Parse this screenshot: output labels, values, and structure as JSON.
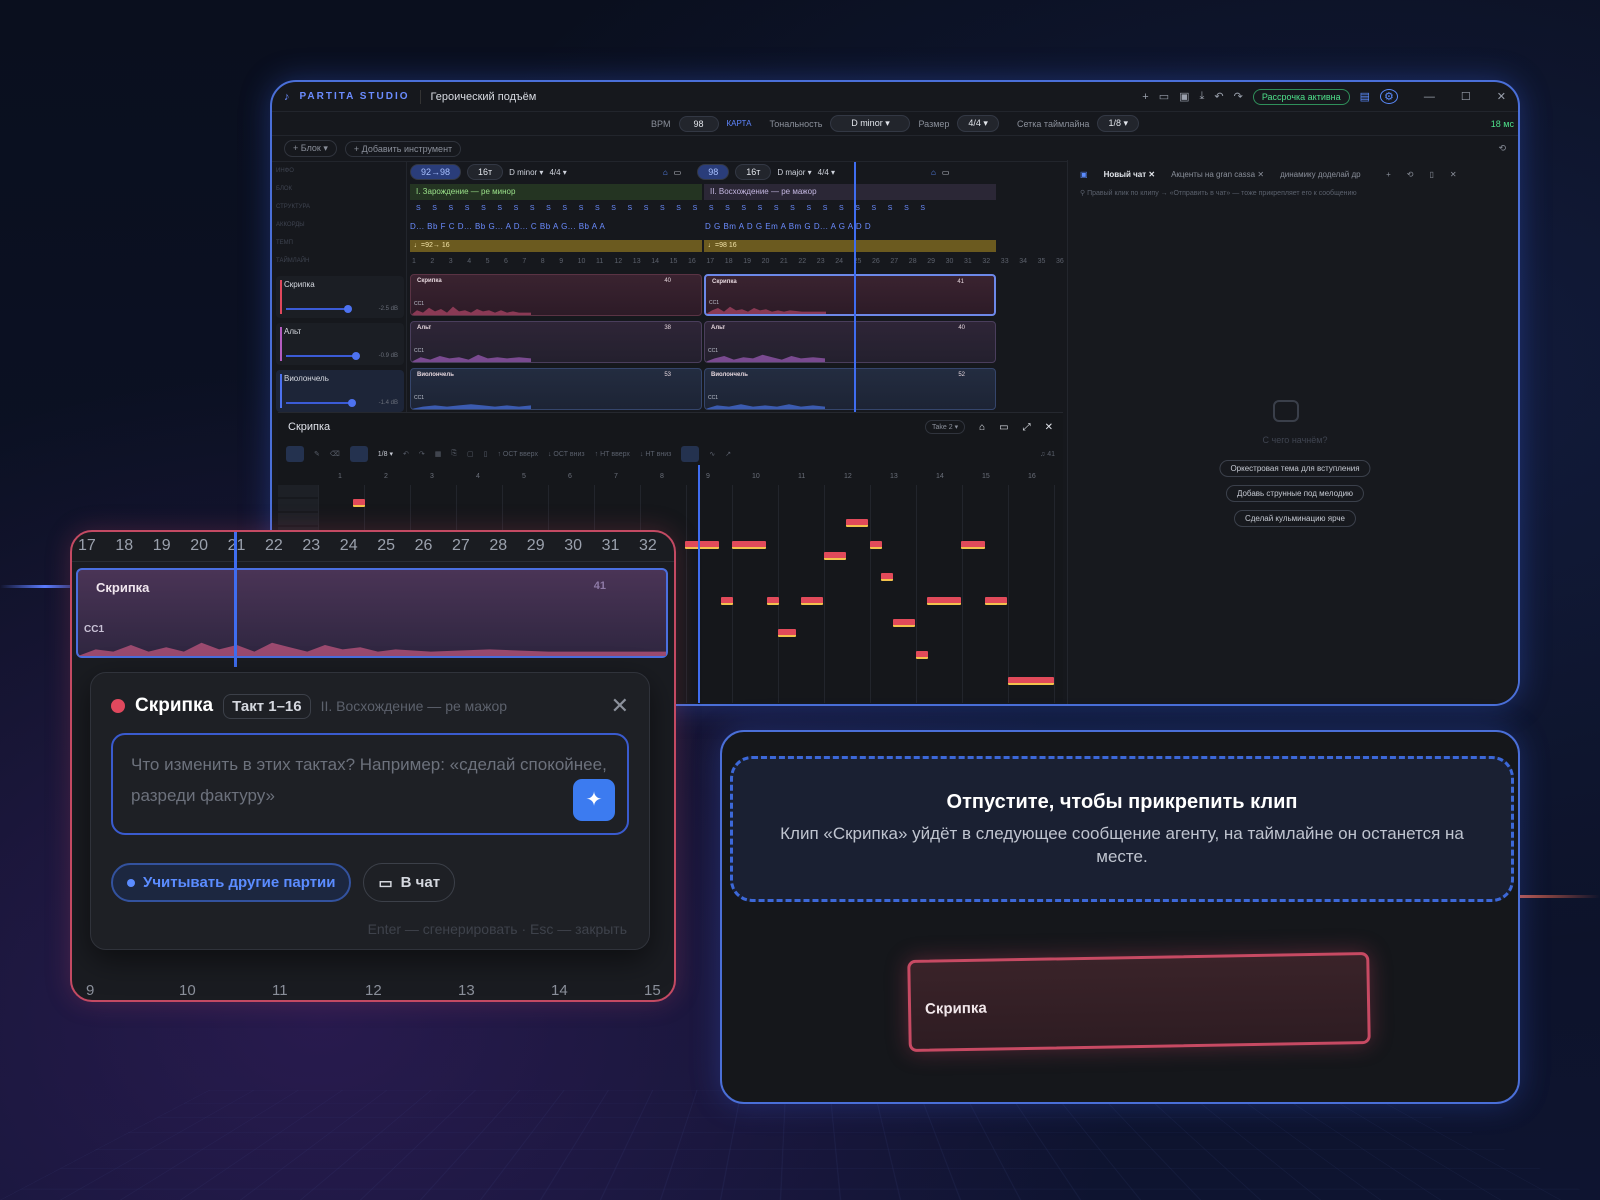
{
  "app": {
    "brand": "PARTITA STUDIO",
    "project_title": "Героический подъём",
    "subscription": "Рассрочка активна"
  },
  "controls": {
    "bpm_label": "BPM",
    "bpm": "98",
    "map_link": "КАРТА",
    "key_label": "Тональность",
    "key": "D minor",
    "meter_label": "Размер",
    "meter": "4/4",
    "grid_label": "Сетка таймлайна",
    "grid": "1/8",
    "latency": "18 мс"
  },
  "toolbar": {
    "block": "Блок",
    "add_instrument": "Добавить инструмент"
  },
  "row_labels": [
    "ИНФО",
    "БЛОК",
    "СТРУКТУРА",
    "АККОРДЫ",
    "ТЕМП",
    "ТАЙМЛАЙН"
  ],
  "blocks": [
    {
      "tempo_chip": "92→98",
      "length": "16т",
      "key": "D minor",
      "meter": "4/4",
      "section": "I. Зарождение — ре минор",
      "chords": "D...  Bb  F  C  D...  Bb  G...  A  D...  C  Bb  A  G...  Bb  A  A",
      "tempo": "♩=92→ 16"
    },
    {
      "tempo_chip": "98",
      "length": "16т",
      "key": "D major",
      "meter": "4/4",
      "section": "II. Восхождение — ре мажор",
      "chords": "D  G  Bm  A  D  G  Em  A  Bm  G  D...  A  G  A  D  D",
      "tempo": "♩=98 16"
    }
  ],
  "bar_numbers": [
    "1",
    "2",
    "3",
    "4",
    "5",
    "6",
    "7",
    "8",
    "9",
    "10",
    "11",
    "12",
    "13",
    "14",
    "15",
    "16",
    "17",
    "18",
    "19",
    "20",
    "21",
    "22",
    "23",
    "24",
    "25",
    "26",
    "27",
    "28",
    "29",
    "30",
    "31",
    "32",
    "33",
    "34",
    "35",
    "36"
  ],
  "tracks": [
    {
      "name": "Скрипка",
      "db": "-2.5 dB",
      "color": "#e0485d",
      "clips": [
        "Скрипка",
        "Скрипка"
      ],
      "nums": [
        "40",
        "41"
      ]
    },
    {
      "name": "Альт",
      "db": "-0.9 dB",
      "color": "#b45cc0",
      "clips": [
        "Альт",
        "Альт"
      ],
      "nums": [
        "38",
        "40"
      ]
    },
    {
      "name": "Виолончель",
      "db": "-1.4 dB",
      "color": "#4d72f0",
      "clips": [
        "Виолончель",
        "Виолончель"
      ],
      "nums": [
        "53",
        "52"
      ]
    }
  ],
  "cc_label": "CC1",
  "chat": {
    "tabs": [
      "Новый чат",
      "Акценты на gran cassa",
      "динамику доделай др"
    ],
    "hint": "Правый клик по клипу → «Отправить в чат» — тоже прикрепляет его к сообщению",
    "empty": "С чего начнём?",
    "suggestions": [
      "Оркестровая тема для вступления",
      "Добавь струнные под мелодию",
      "Сделай кульминацию ярче"
    ]
  },
  "piano_roll": {
    "title": "Скрипка",
    "take": "Take 2",
    "grid": "1/8",
    "tools": [
      "ОСТ вверх",
      "ОСТ вниз",
      "НТ вверх",
      "НТ вниз"
    ],
    "count": "41",
    "ruler": [
      "1",
      "2",
      "3",
      "4",
      "5",
      "6",
      "7",
      "8",
      "9",
      "10",
      "11",
      "12",
      "13",
      "14",
      "15",
      "16"
    ]
  },
  "popup": {
    "ruler": [
      "17",
      "18",
      "19",
      "20",
      "21",
      "22",
      "23",
      "24",
      "25",
      "26",
      "27",
      "28",
      "29",
      "30",
      "31",
      "32"
    ],
    "clip_name": "Скрипка",
    "clip_num": "41",
    "title": "Скрипка",
    "takt": "Такт  1–16",
    "section": "II. Восхождение — ре мажор",
    "placeholder": "Что изменить в этих тактах? Например: «сделай спокойнее, разреди фактуру»",
    "consider": "Учитывать другие партии",
    "to_chat": "В чат",
    "footer": "Enter — сгенерировать · Esc — закрыть",
    "bottom_ruler": [
      "9",
      "10",
      "11",
      "12",
      "13",
      "14",
      "15"
    ]
  },
  "drop": {
    "title": "Отпустите, чтобы прикрепить клип",
    "subtitle": "Клип «Скрипка» уйдёт в следующее сообщение агенту, на таймлайне он останется на месте.",
    "dragged": "Скрипка"
  },
  "colors": {
    "accent": "#4a6fd8",
    "red": "#e0485d",
    "green": "#4ee08a"
  }
}
